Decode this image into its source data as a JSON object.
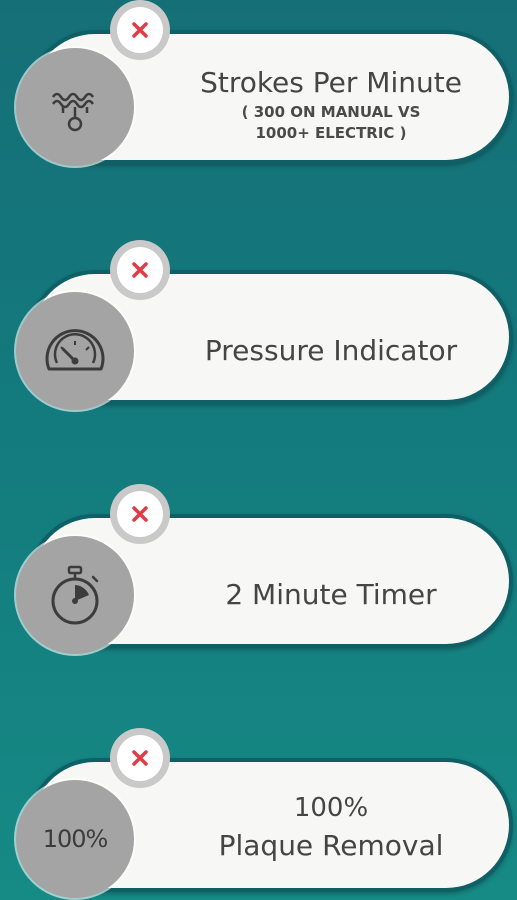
{
  "features": [
    {
      "icon": "water-drops-icon",
      "status_icon": "x-icon",
      "title": "Strokes Per Minute",
      "subtitle": "( 300 ON MANUAL VS\n1000+ ELECTRIC )"
    },
    {
      "icon": "speedometer-icon",
      "status_icon": "x-icon",
      "title": "Pressure Indicator"
    },
    {
      "icon": "stopwatch-icon",
      "status_icon": "x-icon",
      "title": "2 Minute Timer"
    },
    {
      "icon": "percent-icon",
      "icon_text": "100%",
      "status_icon": "x-icon",
      "title": "100%",
      "subtitle": "Plaque Removal"
    }
  ],
  "colors": {
    "background": "#137a7d",
    "card": "#f7f7f5",
    "card_border": "#0f5f66",
    "icon_circle": "#a4a4a4",
    "x_mark": "#e23b46",
    "text": "#454545"
  }
}
